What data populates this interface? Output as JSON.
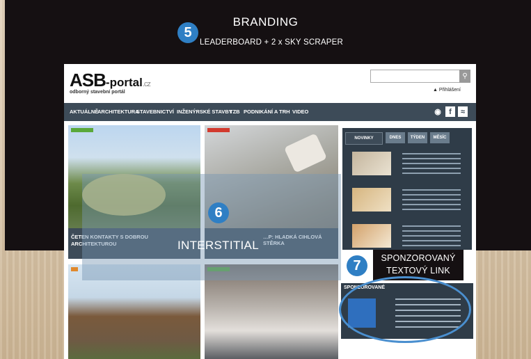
{
  "branding": {
    "badge": "5",
    "title": "BRANDING",
    "subtitle": "LEADERBOARD + 2 x SKY SCRAPER"
  },
  "site": {
    "logo_main": "ASB",
    "logo_portal": "-portal",
    "logo_cz": ".cz",
    "tagline": "odborný stavební portál",
    "login": "Přihlášení",
    "nav": [
      "AKTUÁLNĚ",
      "ARCHITEKTURA",
      "STAVEBNICTVÍ",
      "INŽENÝRSKÉ STAVBY",
      "TZB",
      "PODNIKÁNÍ A TRH",
      "VIDEO"
    ],
    "tiles": [
      {
        "caption": "ČETEN KONTAKTY S DOBROU ARCHITEKTUROU"
      },
      {
        "caption": "…P: HLADKÁ CIHLOVÁ STĚRKA"
      }
    ],
    "sidebar_tabs": [
      "NOVINKY",
      "DNES",
      "TÝDEN",
      "MĚSÍC"
    ],
    "sponsor_heading": "SPONZOROVANÉ"
  },
  "interstitial": {
    "badge": "6",
    "label": "INTERSTITIAL"
  },
  "sponsored_link": {
    "badge": "7",
    "label_line1": "SPONZOROVANÝ",
    "label_line2": "TEXTOVÝ LINK"
  },
  "colors": {
    "badge_blue": "#2f7fc4",
    "highlight_ellipse": "#4a8fcf",
    "dark_band": "#151012",
    "site_nav": "#3d4b58"
  }
}
